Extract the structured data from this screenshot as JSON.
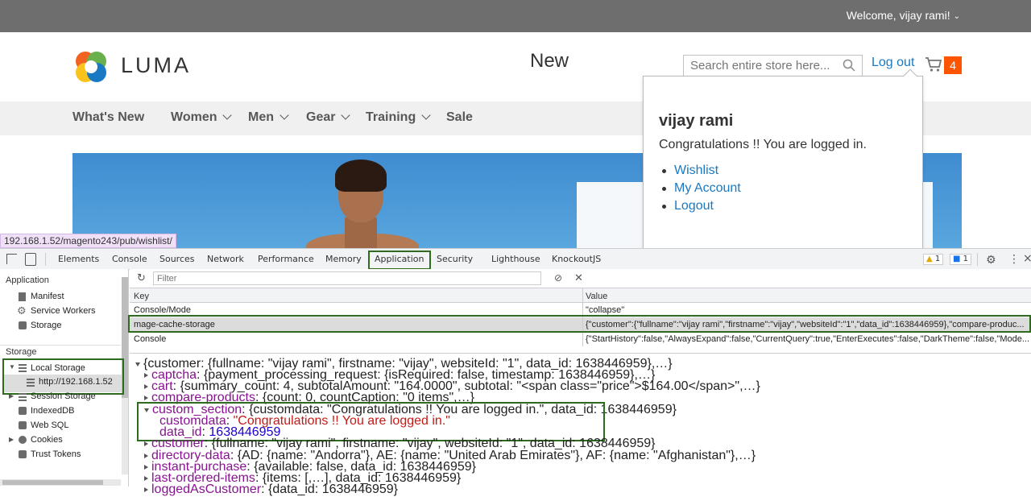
{
  "topbar": {
    "welcome": "Welcome, vijay rami!",
    "welcome_icon": "chevron-down-icon"
  },
  "header": {
    "logo_text": "LUMA",
    "search_placeholder": "Search entire store here...",
    "logout": "Log out",
    "cart_count": "4",
    "brand_color": "#ff5501",
    "link_color": "#1979c3"
  },
  "nav": {
    "items": [
      {
        "label": "What's New",
        "has_menu": false
      },
      {
        "label": "Women",
        "has_menu": true
      },
      {
        "label": "Men",
        "has_menu": true
      },
      {
        "label": "Gear",
        "has_menu": true
      },
      {
        "label": "Training",
        "has_menu": true
      },
      {
        "label": "Sale",
        "has_menu": false
      }
    ]
  },
  "hero": {
    "card_text": "New"
  },
  "account_dropdown": {
    "name": "vijay rami",
    "message": "Congratulations !! You are logged in.",
    "links": [
      "Wishlist",
      "My Account",
      "Logout"
    ]
  },
  "status_url": "192.168.1.52/magento243/pub/wishlist/",
  "devtools": {
    "tabs": [
      "Elements",
      "Console",
      "Sources",
      "Network",
      "Performance",
      "Memory",
      "Application",
      "Security",
      "Lighthouse",
      "KnockoutJS"
    ],
    "active_tab": "Application",
    "warnings": "1",
    "messages": "1",
    "sidebar": {
      "application_header": "Application",
      "application_items": [
        "Manifest",
        "Service Workers",
        "Storage"
      ],
      "storage_header": "Storage",
      "storage_items": [
        "Local Storage",
        "http://192.168.1.52",
        "Session Storage",
        "IndexedDB",
        "Web SQL",
        "Cookies",
        "Trust Tokens"
      ]
    },
    "filter_placeholder": "Filter",
    "table": {
      "headers": [
        "Key",
        "Value"
      ],
      "rows": [
        {
          "key": "Console/Mode",
          "value": "\"collapse\""
        },
        {
          "key": "mage-cache-storage",
          "value": "{\"customer\":{\"fullname\":\"vijay rami\",\"firstname\":\"vijay\",\"websiteId\":\"1\",\"data_id\":1638446959},\"compare-produc..."
        },
        {
          "key": "Console",
          "value": "{\"StartHistory\":false,\"AlwaysExpand\":false,\"CurrentQuery\":true,\"EnterExecutes\":false,\"DarkTheme\":false,\"Mode..."
        }
      ]
    },
    "tree": {
      "root": "{customer: {fullname: \"vijay rami\", firstname: \"vijay\", websiteId: \"1\", data_id: 1638446959},…}",
      "lines": [
        {
          "key": "captcha",
          "value": "{payment_processing_request: {isRequired: false, timestamp: 1638446959},…}"
        },
        {
          "key": "cart",
          "value": "{summary_count: 4, subtotalAmount: \"164.0000\", subtotal: \"<span class=\"price\">$164.00</span>\",…}"
        },
        {
          "key": "compare-products",
          "value": "{count: 0, countCaption: \"0 items\",…}"
        },
        {
          "key": "custom_section",
          "value": "{customdata: \"Congratulations !! You are logged in.\", data_id: 1638446959}"
        },
        {
          "key": "customdata",
          "value": "\"Congratulations !! You are logged in.\""
        },
        {
          "key": "data_id",
          "value": "1638446959"
        },
        {
          "key": "customer",
          "value": "{fullname: \"vijay rami\", firstname: \"vijay\", websiteId: \"1\", data_id: 1638446959}"
        },
        {
          "key": "directory-data",
          "value": "{AD: {name: \"Andorra\"}, AE: {name: \"United Arab Emirates\"}, AF: {name: \"Afghanistan\"},…}"
        },
        {
          "key": "instant-purchase",
          "value": "{available: false, data_id: 1638446959}"
        },
        {
          "key": "last-ordered-items",
          "value": "{items: [,…], data_id: 1638446959}"
        },
        {
          "key": "loggedAsCustomer",
          "value": "{data_id: 1638446959}"
        }
      ]
    }
  }
}
